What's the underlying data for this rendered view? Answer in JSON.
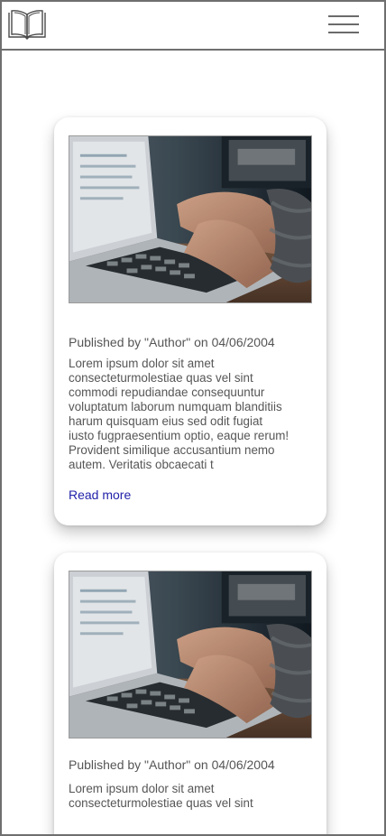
{
  "header": {
    "logo_icon": "open-book-icon",
    "menu_icon": "hamburger-menu-icon"
  },
  "posts": [
    {
      "image_icon": "laptop-typing-photo",
      "meta": "Published by \"Author\" on 04/06/2004",
      "excerpt": "Lorem ipsum dolor sit amet\nconsecteturmolestiae quas vel sint\ncommodi repudiandae consequuntur\nvoluptatum laborum  numquam blanditiis\nharum quisquam eius sed odit fugiat\niusto fugpraesentium optio, eaque rerum!\nProvident similique accusantium nemo\nautem. Veritatis  obcaecati t",
      "read_more": "Read more"
    },
    {
      "image_icon": "laptop-typing-photo",
      "meta": "Published by \"Author\" on 04/06/2004",
      "excerpt": "Lorem ipsum dolor sit amet\nconsecteturmolestiae quas vel sint"
    }
  ],
  "colors": {
    "border": "#6f6f6f",
    "text": "#555555",
    "link": "#2222aa",
    "card_bg": "#ffffff"
  }
}
